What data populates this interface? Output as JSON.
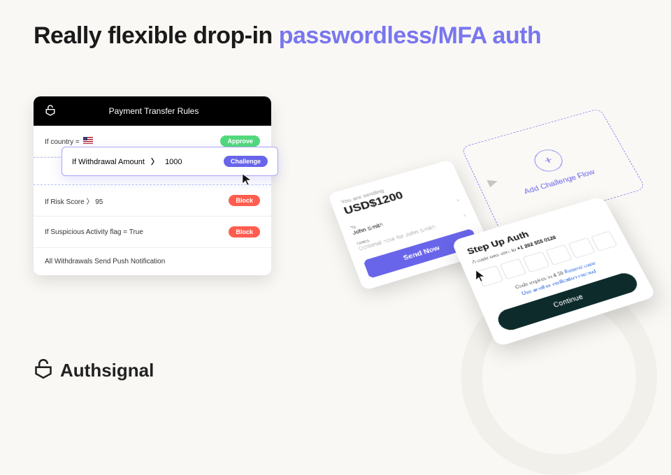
{
  "headline": {
    "part1": "Really flexible drop-in ",
    "part2": "passwordless/MFA auth"
  },
  "rules": {
    "title": "Payment Transfer Rules",
    "row_country_prefix": "If country = ",
    "row_approve": "Approve",
    "row_risk": "If Risk Score  〉 95",
    "row_block": "Block",
    "row_suspicious": "If Suspicious Activity flag = True",
    "row_push": "All Withdrawals Send Push Notification"
  },
  "challenge": {
    "prefix": "If Withdrawal Amount",
    "op": "〉",
    "value": "1000",
    "badge": "Challenge"
  },
  "add_flow": {
    "label": "Add Challenge Flow"
  },
  "send": {
    "heading_small": "You are sending",
    "amount": "USD$1200",
    "to_label": "To",
    "to_value": "John Smith",
    "notes_label": "Notes",
    "notes_value": "Optional note for John Smith",
    "button": "Send Now"
  },
  "stepup": {
    "title": "Step Up Auth",
    "sub_prefix": "A code was sent to ",
    "sub_phone": "+1 202 555 0128",
    "expires_prefix": "Code expires in 4:59 ",
    "resend": "Resend code",
    "alt": "Use another verification method",
    "continue": "Continue"
  },
  "brand": "Authsignal"
}
